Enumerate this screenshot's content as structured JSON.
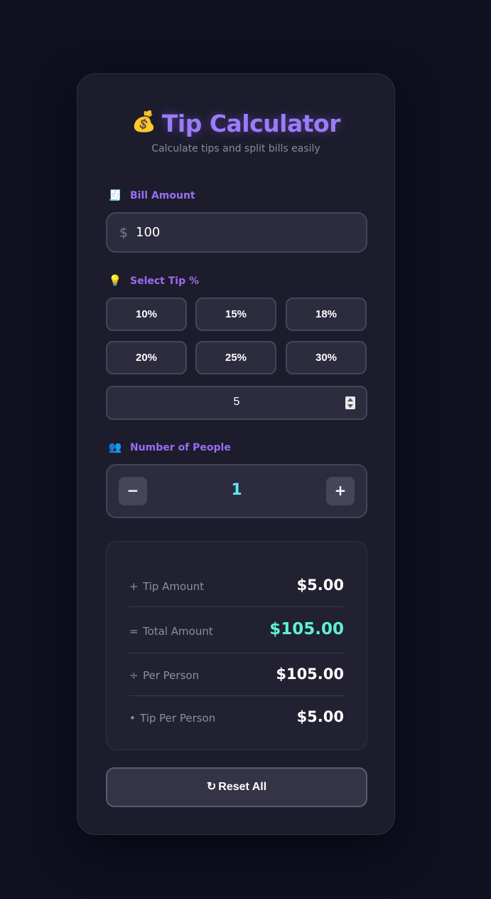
{
  "header": {
    "emoji": "💰",
    "title": "Tip Calculator",
    "subtitle": "Calculate tips and split bills easily"
  },
  "bill": {
    "icon": "🧾",
    "label": "Bill Amount",
    "currency_symbol": "$",
    "value": "100"
  },
  "tip": {
    "icon": "💡",
    "label": "Select Tip %",
    "options": [
      "10%",
      "15%",
      "18%",
      "20%",
      "25%",
      "30%"
    ],
    "custom_value": "5"
  },
  "people": {
    "icon": "👥",
    "label": "Number of People",
    "decrement_label": "−",
    "increment_label": "+",
    "count": "1"
  },
  "results": {
    "rows": [
      {
        "symbol": "+",
        "label": "Tip Amount",
        "value": "$5.00"
      },
      {
        "symbol": "=",
        "label": "Total Amount",
        "value": "$105.00"
      },
      {
        "symbol": "÷",
        "label": "Per Person",
        "value": "$105.00"
      },
      {
        "symbol": "•",
        "label": "Tip Per Person",
        "value": "$5.00"
      }
    ]
  },
  "reset": {
    "icon": "↻",
    "label": "Reset All"
  },
  "colors": {
    "background": "#0f1020",
    "card": "#1c1c2c",
    "accent_purple": "#9b7bf6",
    "accent_cyan": "#5ee8f2",
    "accent_teal": "#5ef0d6"
  }
}
